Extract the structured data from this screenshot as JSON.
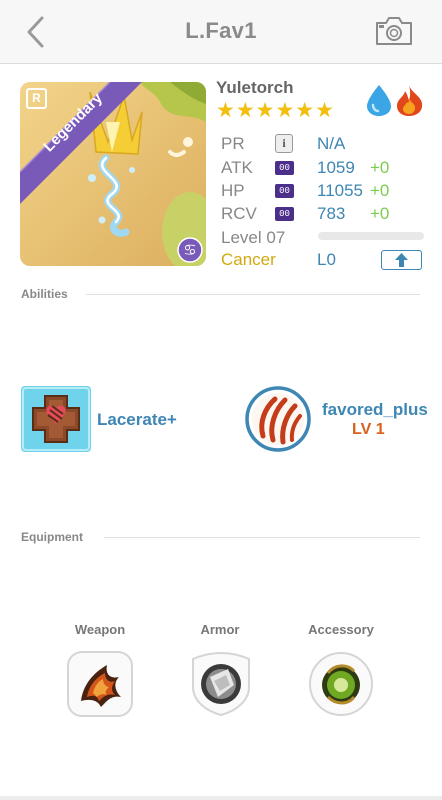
{
  "header": {
    "title": "L.Fav1"
  },
  "card": {
    "rarity": "Legendary",
    "rarity_letter": "R",
    "name": "Yuletorch",
    "stars": "★★★★★★",
    "star_count": 6,
    "elements": [
      "water-drop-icon",
      "fire-icon"
    ]
  },
  "stats": {
    "pr": {
      "label": "PR",
      "badge": "i",
      "value": "N/A"
    },
    "atk": {
      "label": "ATK",
      "badge": "00",
      "value": "1059",
      "plus": "+0"
    },
    "hp": {
      "label": "HP",
      "badge": "00",
      "value": "11055",
      "plus": "+0"
    },
    "rcv": {
      "label": "RCV",
      "badge": "00",
      "value": "783",
      "plus": "+0"
    },
    "level": {
      "label": "Level 07",
      "progress": 0.0
    },
    "sign": "Cancer",
    "limit": "L0"
  },
  "abilities": {
    "section_label": "Abilities",
    "skill": {
      "name": "Lacerate+"
    },
    "passive": {
      "name": "favored_plus",
      "level": "LV 1"
    }
  },
  "equipment": {
    "section_label": "Equipment",
    "weapon_label": "Weapon",
    "armor_label": "Armor",
    "accessory_label": "Accessory"
  },
  "colors": {
    "accent_blue": "#3e86b3",
    "rarity_purple": "#7a5ab8",
    "star_gold": "#f3bf0f",
    "plus_green": "#7ccc4e",
    "level_orange": "#d9601c",
    "sign_gold": "#d3a910"
  }
}
